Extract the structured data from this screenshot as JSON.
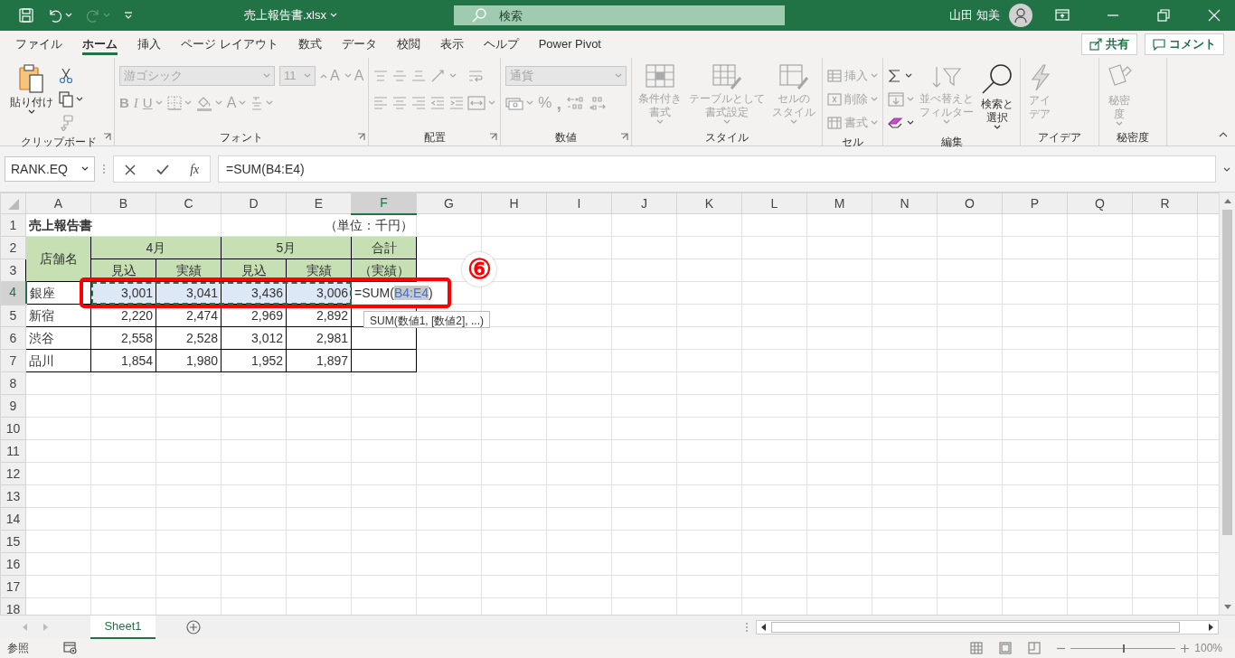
{
  "title_bar": {
    "quick_access": [
      {
        "kind": "save",
        "caret": false,
        "disabled": false
      },
      {
        "kind": "undo",
        "caret": true,
        "disabled": false
      },
      {
        "kind": "redo",
        "caret": true,
        "disabled": true
      },
      {
        "kind": "customize",
        "caret": false,
        "disabled": false
      }
    ],
    "file_name": "売上報告書.xlsx",
    "search": {
      "placeholder": "検索"
    },
    "user": "山田 知美"
  },
  "tabs": [
    {
      "label": "ファイル",
      "selected": false
    },
    {
      "label": "ホーム",
      "selected": true
    },
    {
      "label": "挿入",
      "selected": false
    },
    {
      "label": "ページ レイアウト",
      "selected": false
    },
    {
      "label": "数式",
      "selected": false
    },
    {
      "label": "データ",
      "selected": false
    },
    {
      "label": "校閲",
      "selected": false
    },
    {
      "label": "表示",
      "selected": false
    },
    {
      "label": "ヘルプ",
      "selected": false
    },
    {
      "label": "Power Pivot",
      "selected": false
    }
  ],
  "share_button": "共有",
  "comment_button": "コメント",
  "ribbon": [
    {
      "label": "クリップボード",
      "launcher": true,
      "parts": [
        {
          "kind": "paste",
          "lines": [
            "貼り付け"
          ],
          "caret": true,
          "disabled": false
        },
        {
          "rows": [
            {
              "items": [
                {
                  "kind": "cut",
                  "caret": false,
                  "disabled": false
                }
              ]
            },
            {
              "items": [
                {
                  "kind": "copy",
                  "caret": true,
                  "disabled": false
                }
              ]
            },
            {
              "items": [
                {
                  "kind": "painter",
                  "caret": false,
                  "disabled": true
                }
              ]
            }
          ]
        }
      ]
    },
    {
      "label": "フォント",
      "launcher": true,
      "parts": [
        {
          "rows": [
            {
              "items": [
                {
                  "kind": "font-name",
                  "value": "游ゴシック",
                  "disabled": true
                },
                {
                  "kind": "font-size",
                  "value": "11",
                  "disabled": true
                },
                {
                  "kind": "grow",
                  "label": "A",
                  "caret": false,
                  "disabled": true
                },
                {
                  "kind": "shrink",
                  "label": "A",
                  "caret": false,
                  "disabled": true
                }
              ]
            },
            {
              "items": [
                {
                  "kind": "bold",
                  "label": "B",
                  "caret": false,
                  "disabled": true
                },
                {
                  "kind": "italic",
                  "label": "I",
                  "caret": false,
                  "disabled": true
                },
                {
                  "kind": "underline",
                  "label": "U",
                  "caret": true,
                  "disabled": true
                },
                {
                  "kind": "borders",
                  "caret": true,
                  "disabled": true
                },
                {
                  "kind": "fill",
                  "caret": true,
                  "disabled": true
                },
                {
                  "kind": "font-color",
                  "label": "A",
                  "caret": true,
                  "disabled": true
                },
                {
                  "kind": "phonetic",
                  "caret": true,
                  "disabled": true
                }
              ]
            }
          ]
        }
      ]
    },
    {
      "label": "配置",
      "launcher": true,
      "parts": [
        {
          "rows": [
            {
              "items": [
                {
                  "kind": "align-top",
                  "caret": false,
                  "disabled": true
                },
                {
                  "kind": "align-middle",
                  "caret": false,
                  "disabled": true
                },
                {
                  "kind": "align-bottom",
                  "caret": false,
                  "disabled": true
                },
                {
                  "kind": "orientation",
                  "caret": true,
                  "disabled": true
                }
              ]
            },
            {
              "items": [
                {
                  "kind": "align-left",
                  "caret": false,
                  "disabled": true
                },
                {
                  "kind": "align-center",
                  "caret": false,
                  "disabled": true
                },
                {
                  "kind": "align-right",
                  "caret": false,
                  "disabled": true
                },
                {
                  "kind": "outdent",
                  "caret": false,
                  "disabled": true
                },
                {
                  "kind": "indent",
                  "caret": false,
                  "disabled": true
                }
              ]
            }
          ]
        },
        {
          "rows": [
            {
              "items": [
                {
                  "kind": "wrap",
                  "caret": false,
                  "disabled": true
                }
              ]
            },
            {
              "items": [
                {
                  "kind": "merge",
                  "caret": true,
                  "disabled": true
                }
              ]
            }
          ]
        }
      ]
    },
    {
      "label": "数値",
      "launcher": true,
      "parts": [
        {
          "rows": [
            {
              "items": [
                {
                  "kind": "number-format",
                  "value": "通貨",
                  "disabled": true
                }
              ]
            },
            {
              "items": [
                {
                  "kind": "accounting",
                  "caret": true,
                  "disabled": true
                },
                {
                  "kind": "percent",
                  "label": "%",
                  "caret": false,
                  "disabled": true
                },
                {
                  "kind": "comma",
                  "label": ",",
                  "caret": false,
                  "disabled": true
                },
                {
                  "kind": "inc-decimal",
                  "caret": false,
                  "disabled": true
                },
                {
                  "kind": "dec-decimal",
                  "caret": false,
                  "disabled": true
                }
              ]
            }
          ]
        }
      ]
    },
    {
      "label": "スタイル",
      "launcher": false,
      "parts": [
        {
          "kind": "conditional",
          "lines": [
            "条件付き",
            "書式"
          ],
          "caret": true,
          "disabled": true
        },
        {
          "kind": "table-format",
          "lines": [
            "テーブルとして",
            "書式設定"
          ],
          "caret": true,
          "disabled": true
        },
        {
          "kind": "cell-styles",
          "lines": [
            "セルの",
            "スタイル"
          ],
          "caret": true,
          "disabled": true
        }
      ]
    },
    {
      "label": "セル",
      "launcher": false,
      "parts": [
        {
          "rows": [
            {
              "items": [
                {
                  "kind": "insert",
                  "label": "挿入",
                  "caret": true,
                  "disabled": true
                }
              ]
            },
            {
              "items": [
                {
                  "kind": "delete",
                  "label": "削除",
                  "caret": true,
                  "disabled": true
                }
              ]
            },
            {
              "items": [
                {
                  "kind": "format",
                  "label": "書式",
                  "caret": true,
                  "disabled": true
                }
              ]
            }
          ]
        }
      ]
    },
    {
      "label": "編集",
      "launcher": false,
      "parts": [
        {
          "rows": [
            {
              "items": [
                {
                  "kind": "autosum",
                  "caret": true,
                  "disabled": false
                }
              ]
            },
            {
              "items": [
                {
                  "kind": "fill-down",
                  "caret": true,
                  "disabled": true
                }
              ]
            },
            {
              "items": [
                {
                  "kind": "clear",
                  "caret": true,
                  "disabled": false
                }
              ]
            }
          ]
        },
        {
          "kind": "sort",
          "lines": [
            "並べ替えと",
            "フィルター"
          ],
          "caret": true,
          "disabled": true
        },
        {
          "kind": "find",
          "lines": [
            "検索と",
            "選択"
          ],
          "caret": true,
          "disabled": false
        }
      ]
    },
    {
      "label": "アイデア",
      "launcher": false,
      "parts": [
        {
          "kind": "ideas",
          "lines": [
            "アイ",
            "デア"
          ],
          "caret": false,
          "disabled": true
        }
      ]
    },
    {
      "label": "秘密度",
      "launcher": false,
      "parts": [
        {
          "kind": "sensitivity",
          "lines": [
            "秘密",
            "度"
          ],
          "caret": true,
          "disabled": true
        }
      ]
    }
  ],
  "formula_bar": {
    "name_box": "RANK.EQ",
    "insert_function": "fx",
    "formula": "=SUM(B4:E4)"
  },
  "columns": [
    {
      "label": "A",
      "selected": false
    },
    {
      "label": "B",
      "selected": false
    },
    {
      "label": "C",
      "selected": false
    },
    {
      "label": "D",
      "selected": false
    },
    {
      "label": "E",
      "selected": false
    },
    {
      "label": "F",
      "selected": true
    },
    {
      "label": "G",
      "selected": false
    },
    {
      "label": "H",
      "selected": false
    },
    {
      "label": "I",
      "selected": false
    },
    {
      "label": "J",
      "selected": false
    },
    {
      "label": "K",
      "selected": false
    },
    {
      "label": "L",
      "selected": false
    },
    {
      "label": "M",
      "selected": false
    },
    {
      "label": "N",
      "selected": false
    },
    {
      "label": "O",
      "selected": false
    },
    {
      "label": "P",
      "selected": false
    },
    {
      "label": "Q",
      "selected": false
    },
    {
      "label": "R",
      "selected": false
    }
  ],
  "row_headers": [
    {
      "label": "1",
      "selected": false
    },
    {
      "label": "2",
      "selected": false
    },
    {
      "label": "3",
      "selected": false
    },
    {
      "label": "4",
      "selected": true
    },
    {
      "label": "5",
      "selected": false
    },
    {
      "label": "6",
      "selected": false
    },
    {
      "label": "7",
      "selected": false
    },
    {
      "label": "8",
      "selected": false
    },
    {
      "label": "9",
      "selected": false
    },
    {
      "label": "10",
      "selected": false
    },
    {
      "label": "11",
      "selected": false
    },
    {
      "label": "12",
      "selected": false
    },
    {
      "label": "13",
      "selected": false
    },
    {
      "label": "14",
      "selected": false
    },
    {
      "label": "15",
      "selected": false
    },
    {
      "label": "16",
      "selected": false
    },
    {
      "label": "17",
      "selected": false
    },
    {
      "label": "18",
      "selected": false
    }
  ],
  "report": {
    "title": "売上報告書",
    "unit": "（単位：千円）",
    "store_header": "店舗名",
    "months": [
      {
        "label": "4月",
        "columns": [
          "見込",
          "実績"
        ]
      },
      {
        "label": "5月",
        "columns": [
          "見込",
          "実績"
        ]
      }
    ],
    "total_header": [
      "合計",
      "（実績）"
    ],
    "rows": [
      {
        "store": "銀座",
        "values": [
          "3,001",
          "3,041",
          "3,436",
          "3,006"
        ],
        "in_range": true,
        "edit": {
          "before": "=SUM(",
          "ref": "B4:E4",
          "after": ")"
        }
      },
      {
        "store": "新宿",
        "values": [
          "2,220",
          "2,474",
          "2,969",
          "2,892"
        ],
        "in_range": false
      },
      {
        "store": "渋谷",
        "values": [
          "2,558",
          "2,528",
          "3,012",
          "2,981"
        ],
        "in_range": false
      },
      {
        "store": "品川",
        "values": [
          "1,854",
          "1,980",
          "1,952",
          "1,897"
        ],
        "in_range": false
      }
    ]
  },
  "annotation": {
    "step": "⑥"
  },
  "tooltip": "SUM(数値1, [数値2], ...)",
  "sheet_tabs": [
    {
      "label": "Sheet1",
      "selected": true
    }
  ],
  "status_bar": {
    "mode": "参照",
    "zoom": {
      "level": 0.5,
      "reading": "100%"
    }
  }
}
